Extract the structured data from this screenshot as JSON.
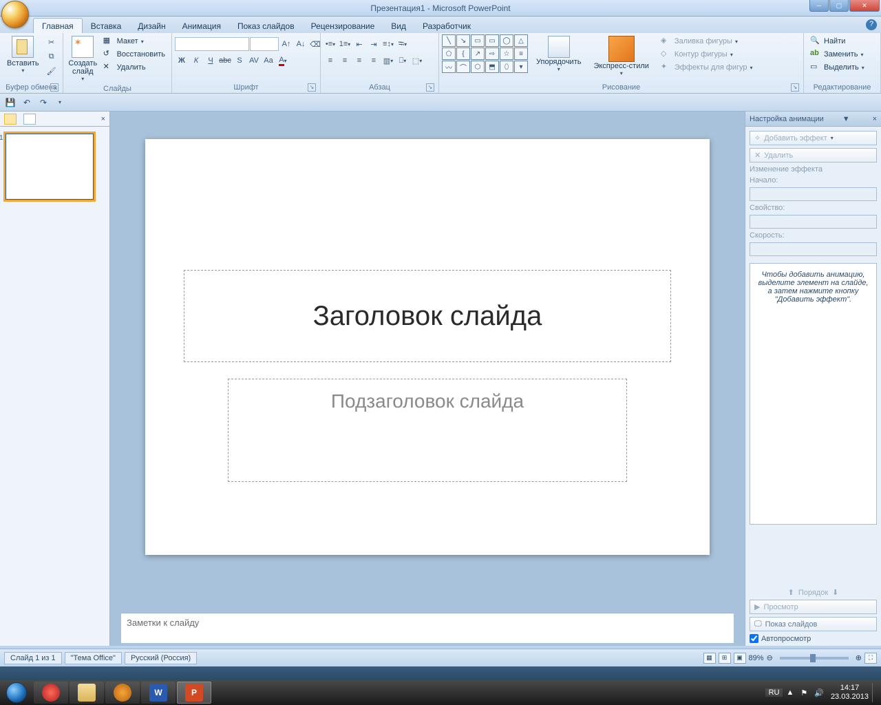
{
  "title": {
    "doc": "Презентация1",
    "app": "Microsoft PowerPoint"
  },
  "tabs": [
    "Главная",
    "Вставка",
    "Дизайн",
    "Анимация",
    "Показ слайдов",
    "Рецензирование",
    "Вид",
    "Разработчик"
  ],
  "active_tab": 0,
  "ribbon": {
    "clipboard": {
      "label": "Буфер обмена",
      "paste": "Вставить"
    },
    "slides": {
      "label": "Слайды",
      "new": "Создать\nслайд",
      "layout": "Макет",
      "reset": "Восстановить",
      "delete": "Удалить"
    },
    "font": {
      "label": "Шрифт"
    },
    "paragraph": {
      "label": "Абзац"
    },
    "drawing": {
      "label": "Рисование",
      "arrange": "Упорядочить",
      "quick": "Экспресс-стили",
      "fill": "Заливка фигуры",
      "outline": "Контур фигуры",
      "effects": "Эффекты для фигур"
    },
    "editing": {
      "label": "Редактирование",
      "find": "Найти",
      "replace": "Заменить",
      "select": "Выделить"
    }
  },
  "slide": {
    "title_placeholder": "Заголовок слайда",
    "subtitle_placeholder": "Подзаголовок слайда",
    "notes_placeholder": "Заметки к слайду"
  },
  "anim_pane": {
    "title": "Настройка анимации",
    "add": "Добавить эффект",
    "remove": "Удалить",
    "change": "Изменение эффекта",
    "start": "Начало:",
    "property": "Свойство:",
    "speed": "Скорость:",
    "help": "Чтобы добавить анимацию, выделите элемент на слайде, а затем нажмите кнопку \"Добавить эффект\".",
    "order": "Порядок",
    "preview": "Просмотр",
    "slideshow": "Показ слайдов",
    "autopreview": "Автопросмотр"
  },
  "status": {
    "slide": "Слайд 1 из 1",
    "theme": "\"Тема Office\"",
    "lang": "Русский (Россия)",
    "zoom": "89%"
  },
  "tray": {
    "lang": "RU",
    "time": "14:17",
    "date": "23.03.2013"
  }
}
